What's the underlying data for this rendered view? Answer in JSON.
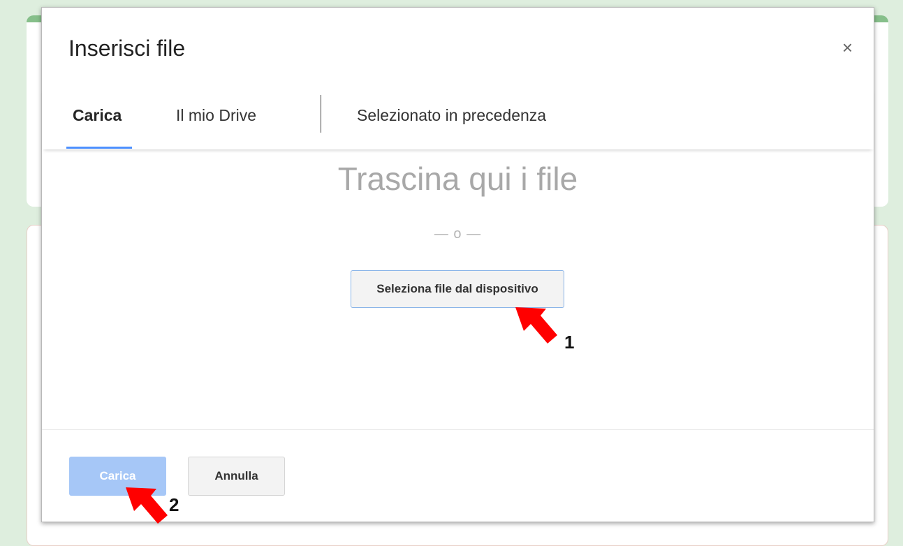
{
  "dialog": {
    "title": "Inserisci file",
    "close_symbol": "×"
  },
  "tabs": [
    {
      "label": "Carica",
      "active": true
    },
    {
      "label": "Il mio Drive",
      "active": false
    },
    {
      "label": "Selezionato in precedenza",
      "active": false
    }
  ],
  "upload_area": {
    "drop_text": "Trascina qui i file",
    "or_text": "— o —",
    "select_button_label": "Seleziona file dal dispositivo"
  },
  "footer": {
    "upload_label": "Carica",
    "cancel_label": "Annulla"
  },
  "annotations": {
    "marker_1": "1",
    "marker_2": "2"
  },
  "colors": {
    "accent_blue": "#4d90fe",
    "disabled_button": "#a6c7f7",
    "annotation_arrow": "#ff0000",
    "page_background": "#deeede"
  }
}
